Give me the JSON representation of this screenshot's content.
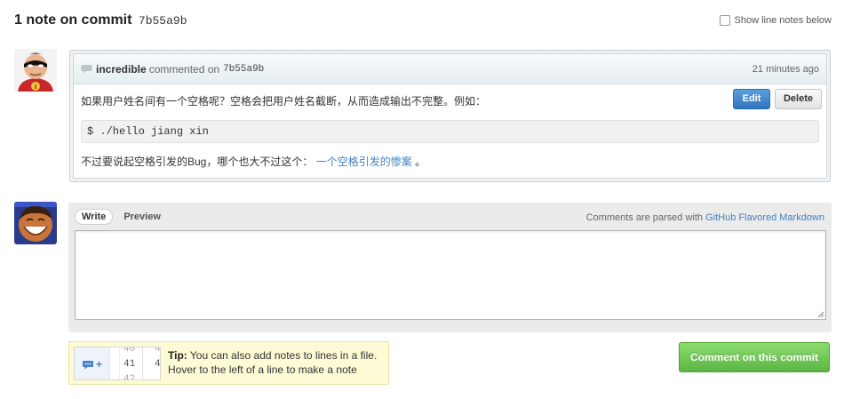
{
  "header": {
    "title": "1 note on commit",
    "sha": "7b55a9b",
    "show_line_notes_label": "Show line notes below"
  },
  "comment": {
    "author": "incredible",
    "action": "commented on",
    "sha": "7b55a9b",
    "time": "21 minutes ago",
    "edit_label": "Edit",
    "delete_label": "Delete",
    "body_line1": "如果用户姓名间有一个空格呢？空格会把用户姓名截断，从而造成输出不完整。例如：",
    "code": "$ ./hello jiang xin",
    "body_line2_prefix": "不过要说起空格引发的Bug，哪个也大不过这个：",
    "link_text": "一个空格引发的惨案",
    "body_line2_suffix": "。"
  },
  "form": {
    "tab_write": "Write",
    "tab_preview": "Preview",
    "md_note_prefix": "Comments are parsed with",
    "md_link": "GitHub Flavored Markdown",
    "textarea_value": ""
  },
  "tip": {
    "label": "Tip:",
    "line1": "You can also add notes to lines in a file.",
    "line2": "Hover to the left of a line to make a note",
    "img_num_top": "40",
    "img_num_mid": "41",
    "img_num_mid2": "4",
    "img_num_bottom": "42",
    "img_num_top2": "4"
  },
  "submit_label": "Comment on this commit",
  "colors": {
    "link": "#4183c4",
    "edit_button": "#2f74bf",
    "submit_button": "#5cb544",
    "tip_background": "#fdfbd5"
  },
  "icons": {
    "comment_bubble": "speech-bubble-icon",
    "resize": "resize-grip-icon",
    "add_note": "add-note-icon"
  }
}
